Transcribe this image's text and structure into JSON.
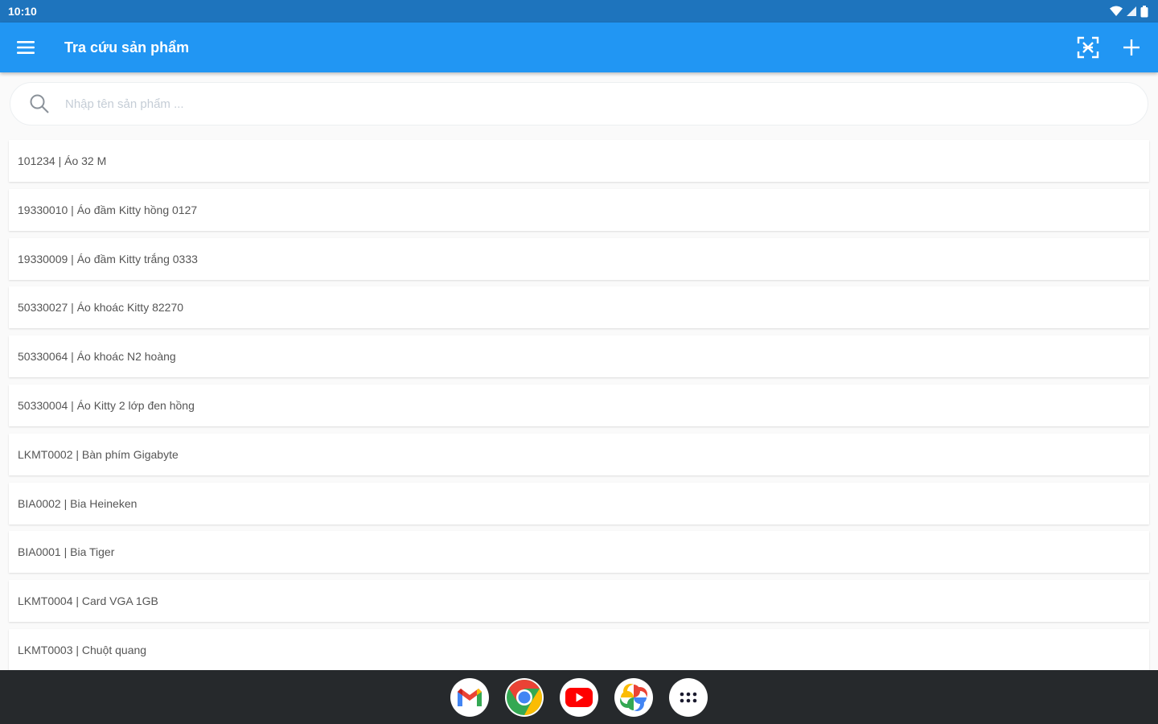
{
  "status_bar": {
    "time": "10:10"
  },
  "app_bar": {
    "title": "Tra cứu sản phẩm"
  },
  "search": {
    "placeholder": "Nhập tên sản phẩm ...",
    "value": ""
  },
  "products": [
    "101234 | Áo 32 M",
    "19330010 | Áo đầm Kitty hồng 0127",
    "19330009 | Áo đầm Kitty trắng 0333",
    "50330027 | Áo khoác Kitty 82270",
    "50330064 | Áo khoác N2 hoàng",
    "50330004 | Áo Kitty 2 lớp đen hồng",
    "LKMT0002 | Bàn phím Gigabyte",
    "BIA0002 | Bia Heineken",
    "BIA0001 | Bia Tiger",
    "LKMT0004 | Card VGA 1GB",
    "LKMT0003 | Chuột quang"
  ],
  "colors": {
    "app_bar": "#2196f3",
    "status_bar": "#1e74bd",
    "dock": "#26292c"
  },
  "dock_apps": [
    "gmail-icon",
    "chrome-icon",
    "youtube-icon",
    "photos-icon",
    "app-drawer-icon"
  ]
}
